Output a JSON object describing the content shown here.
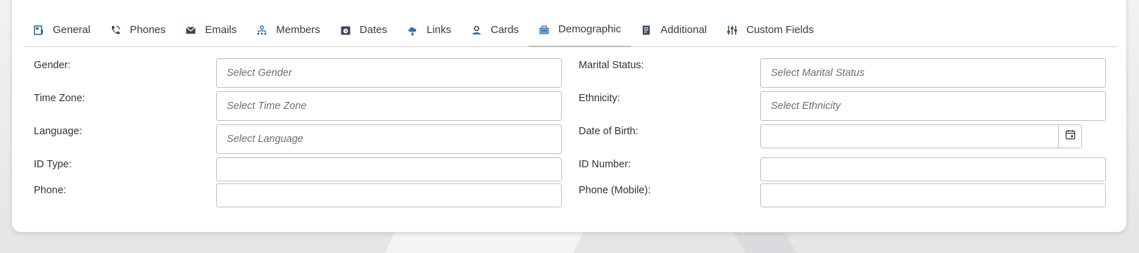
{
  "tabs": [
    {
      "label": "General",
      "icon": "general-icon"
    },
    {
      "label": "Phones",
      "icon": "phone-icon"
    },
    {
      "label": "Emails",
      "icon": "email-icon"
    },
    {
      "label": "Members",
      "icon": "members-icon"
    },
    {
      "label": "Dates",
      "icon": "calendar-icon"
    },
    {
      "label": "Links",
      "icon": "cloud-link-icon"
    },
    {
      "label": "Cards",
      "icon": "card-user-icon"
    },
    {
      "label": "Demographic",
      "icon": "demographic-icon",
      "active": true
    },
    {
      "label": "Additional",
      "icon": "additional-icon"
    },
    {
      "label": "Custom Fields",
      "icon": "sliders-icon"
    }
  ],
  "form": {
    "left": {
      "gender": {
        "label": "Gender:",
        "placeholder": "Select Gender"
      },
      "time_zone": {
        "label": "Time Zone:",
        "placeholder": "Select Time Zone"
      },
      "language": {
        "label": "Language:",
        "placeholder": "Select Language"
      },
      "id_type": {
        "label": "ID Type:",
        "value": ""
      },
      "phone": {
        "label": "Phone:",
        "value": ""
      }
    },
    "right": {
      "marital_status": {
        "label": "Marital Status:",
        "placeholder": "Select Marital Status"
      },
      "ethnicity": {
        "label": "Ethnicity:",
        "placeholder": "Select Ethnicity"
      },
      "date_of_birth": {
        "label": "Date of Birth:",
        "value": ""
      },
      "id_number": {
        "label": "ID Number:",
        "value": ""
      },
      "phone_mobile": {
        "label": "Phone (Mobile):",
        "value": ""
      }
    }
  },
  "colors": {
    "icon_blue": "#2f6fa8",
    "icon_dark": "#3a4a5a",
    "border": "#bdbdbd"
  }
}
